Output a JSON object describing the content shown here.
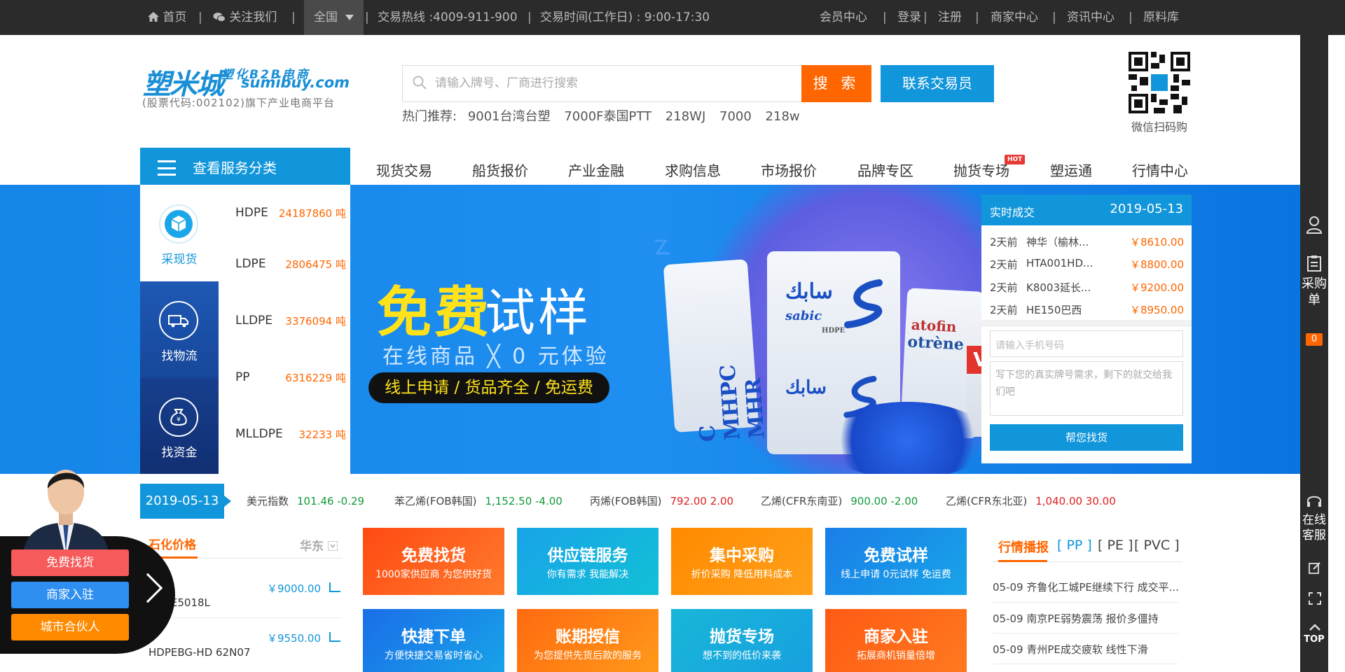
{
  "topbar": {
    "home": "首页",
    "follow": "关注我们",
    "region": "全国",
    "hotline": "交易热线 :4009-911-900",
    "hours": "交易时间(工作日) : 9:00-17:30",
    "links": [
      "会员中心",
      "登录",
      "注册",
      "商家中心",
      "资讯中心",
      "原料库"
    ]
  },
  "header": {
    "logo_main": "塑米城",
    "logo_sub1": "塑化B2B电商",
    "logo_sub2": "sumibuy.com",
    "logo_code": "(股票代码:002102)旗下产业电商平台",
    "search_placeholder": "请输入牌号、厂商进行搜索",
    "search_button": "搜 索",
    "contact_button": "联系交易员",
    "hot_label": "热门推荐:",
    "hot_items": [
      "9001台湾台塑",
      "7000F泰国PTT",
      "218WJ",
      "7000",
      "218w"
    ],
    "qr_label": "微信扫码购"
  },
  "nav": {
    "category_button": "查看服务分类",
    "links": [
      "现货交易",
      "船货报价",
      "产业金融",
      "求购信息",
      "市场报价",
      "品牌专区",
      "抛货专场",
      "塑运通",
      "行情中心"
    ],
    "hot_badge": "HOT"
  },
  "side_menu": {
    "items": [
      {
        "label": "采现货",
        "icon": "cube-icon"
      },
      {
        "label": "找物流",
        "icon": "truck-icon"
      },
      {
        "label": "找资金",
        "icon": "money-bag-icon"
      }
    ]
  },
  "stats": [
    {
      "name": "HDPE",
      "value": "24187860 吨"
    },
    {
      "name": "LDPE",
      "value": "2806475 吨"
    },
    {
      "name": "LLDPE",
      "value": "3376094 吨"
    },
    {
      "name": "PP",
      "value": "6316229 吨"
    },
    {
      "name": "MLLDPE",
      "value": "32233 吨"
    }
  ],
  "banner": {
    "title_yellow": "免费",
    "title_white": "试样",
    "subtitle": "在线商品 ╳ 0 元体验",
    "pill": "线上申请 / 货品齐全 / 免运费",
    "bag_brand": "سابك",
    "bag_text1": "sabic",
    "bag_text2": "HDPE",
    "bag_text3": "C MHPC MHR",
    "bag_text4": "atofin",
    "bag_text5": "otrène",
    "bag_text6": "VA",
    "slide_count": 6,
    "active_slide": 4
  },
  "realtime": {
    "title": "实时成交",
    "date": "2019-05-13",
    "rows": [
      {
        "time": "2天前",
        "name": "神华（榆林...",
        "price": "￥8610.00"
      },
      {
        "time": "2天前",
        "name": "HTA001HD...",
        "price": "￥8800.00"
      },
      {
        "time": "2天前",
        "name": "K8003延长...",
        "price": "￥9200.00"
      },
      {
        "time": "2天前",
        "name": "HE150巴西",
        "price": "￥8950.00"
      }
    ],
    "phone_placeholder": "请输入手机号码",
    "message_placeholder": "写下您的真实牌号需求，剩下的就交给我们吧",
    "submit_button": "帮您找货"
  },
  "ticker": {
    "date": "2019-05-13",
    "items": [
      {
        "name": "美元指数",
        "value": "101.46 -0.29",
        "trend": "down"
      },
      {
        "name": "苯乙烯(FOB韩国)",
        "value": "1,152.50 -4.00",
        "trend": "down"
      },
      {
        "name": "丙烯(FOB韩国)",
        "value": "792.00 2.00",
        "trend": "up"
      },
      {
        "name": "乙烯(CFR东南亚)",
        "value": "900.00 -2.00",
        "trend": "down"
      },
      {
        "name": "乙烯(CFR东北亚)",
        "value": "1,040.00 30.00",
        "trend": "up"
      }
    ]
  },
  "price_panel": {
    "title": "石化价格",
    "region": "华东",
    "rows": [
      {
        "name": "HDPE5018L",
        "price": "￥9000.00"
      },
      {
        "name": "HDPEBG-HD 62N07",
        "price": "￥9550.00"
      }
    ]
  },
  "tiles": [
    {
      "title": "免费找货",
      "sub": "1000家供应商 为您供好货",
      "color": "#ff5a1a"
    },
    {
      "title": "供应链服务",
      "sub": "你有需求 我能解决",
      "color": "#1aa6e0"
    },
    {
      "title": "集中采购",
      "sub": "折价采购 降低用料成本",
      "color": "#ff8a00"
    },
    {
      "title": "免费试样",
      "sub": "线上申请 0元试样 免运费",
      "color": "#1e8ae6"
    },
    {
      "title": "快捷下单",
      "sub": "方便快捷交易省时省心",
      "color": "#1a7ee8"
    },
    {
      "title": "账期授信",
      "sub": "为您提供先货后款的服务",
      "color": "#ff8a10"
    },
    {
      "title": "抛货专场",
      "sub": "想不到的低价来袭",
      "color": "#19b0d8"
    },
    {
      "title": "商家入驻",
      "sub": "拓展商机销量倍增",
      "color": "#ff5a1a"
    }
  ],
  "news": {
    "title": "行情播报",
    "tabs": [
      "[ PP ]",
      "[ PE ]",
      "[ PVC ]"
    ],
    "items": [
      "05-09 齐鲁化工城PE继续下行 成交平...",
      "05-09 南京PE弱势震荡 报价多僵持",
      "05-09 青州PE成交疲软 线性下滑"
    ]
  },
  "rail": {
    "cart_label": "采购单",
    "cart_count": "0",
    "service_label": "在线客服",
    "top_label": "TOP"
  },
  "float": {
    "buttons": [
      "免费找货",
      "商家入驻",
      "城市合伙人"
    ]
  },
  "colors": {
    "accent_blue": "#1296db",
    "accent_orange": "#ff6600",
    "topbar": "#2b2b2b"
  }
}
